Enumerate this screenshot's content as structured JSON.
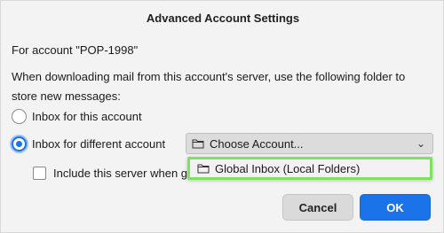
{
  "dialog": {
    "title": "Advanced Account Settings",
    "for_account": "For account \"POP-1998\"",
    "description": "When downloading mail from this account's server, use the following folder to store new messages:",
    "options": [
      {
        "label": "Inbox for this account",
        "selected": false
      },
      {
        "label": "Inbox for different account",
        "selected": true
      }
    ],
    "checkbox_label": "Include this server when g",
    "select": {
      "value": "Choose Account...",
      "icon": "folder-icon"
    },
    "dropdown_items": [
      {
        "label": "Global Inbox (Local Folders)",
        "icon": "folder-icon"
      }
    ],
    "buttons": {
      "cancel": "Cancel",
      "ok": "OK"
    },
    "colors": {
      "accent": "#1a73e8",
      "highlight": "#7ee25f"
    }
  }
}
